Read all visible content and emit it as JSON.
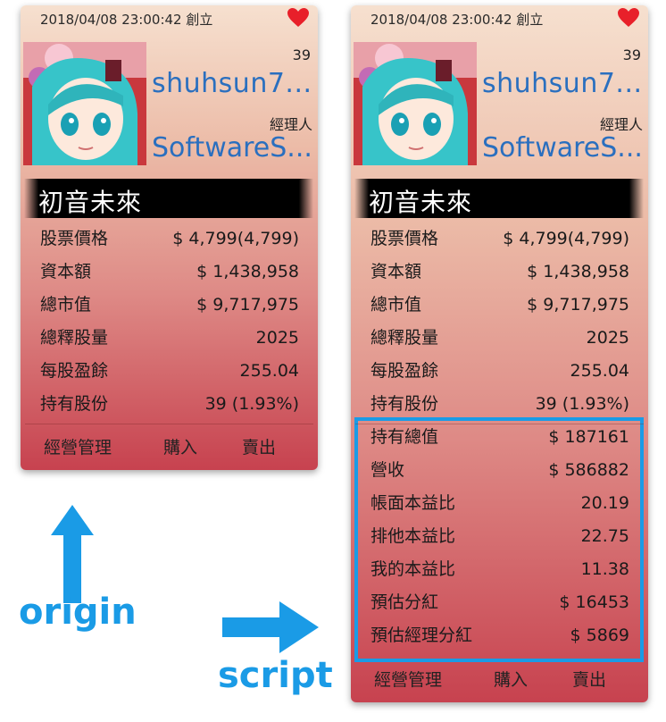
{
  "origin": {
    "date": "2018/04/08 23:00:42 創立",
    "count": "39",
    "owner": "shuhsun7...",
    "role": "經理人",
    "team": "SoftwareS...",
    "stock_name": "初音未來",
    "stats": [
      {
        "label": "股票價格",
        "value": "$ 4,799(4,799)"
      },
      {
        "label": "資本額",
        "value": "$ 1,438,958"
      },
      {
        "label": "總市值",
        "value": "$ 9,717,975"
      },
      {
        "label": "總釋股量",
        "value": "2025"
      },
      {
        "label": "每股盈餘",
        "value": "255.04"
      },
      {
        "label": "持有股份",
        "value": "39 (1.93%)"
      }
    ],
    "actions": {
      "manage": "經營管理",
      "buy": "購入",
      "sell": "賣出"
    }
  },
  "script": {
    "date": "2018/04/08 23:00:42 創立",
    "count": "39",
    "owner": "shuhsun7...",
    "role": "經理人",
    "team": "SoftwareS...",
    "stock_name": "初音未來",
    "stats": [
      {
        "label": "股票價格",
        "value": "$ 4,799(4,799)"
      },
      {
        "label": "資本額",
        "value": "$ 1,438,958"
      },
      {
        "label": "總市值",
        "value": "$ 9,717,975"
      },
      {
        "label": "總釋股量",
        "value": "2025"
      },
      {
        "label": "每股盈餘",
        "value": "255.04"
      },
      {
        "label": "持有股份",
        "value": "39 (1.93%)"
      }
    ],
    "extra_stats": [
      {
        "label": "持有總值",
        "value": "$ 187161"
      },
      {
        "label": "營收",
        "value": "$ 586882"
      },
      {
        "label": "帳面本益比",
        "value": "20.19"
      },
      {
        "label": "排他本益比",
        "value": "22.75"
      },
      {
        "label": "我的本益比",
        "value": "11.38"
      },
      {
        "label": "預估分紅",
        "value": "$ 16453"
      },
      {
        "label": "預估經理分紅",
        "value": "$ 5869"
      }
    ],
    "actions": {
      "manage": "經營管理",
      "buy": "購入",
      "sell": "賣出"
    }
  },
  "annotations": {
    "origin_label": "origin",
    "script_label": "script"
  },
  "colors": {
    "accent": "#1a9be6",
    "link": "#2a6fbf",
    "heart": "#e8202a"
  },
  "icons": {
    "favorite": "heart-icon",
    "avatar": "anime-avatar-image"
  }
}
